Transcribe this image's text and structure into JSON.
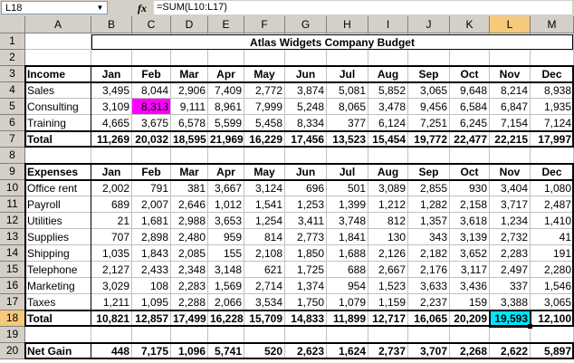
{
  "formula_bar": {
    "name_box": "L18",
    "fx_label": "fx",
    "formula": "=SUM(L10:L17)"
  },
  "columns": [
    "A",
    "B",
    "C",
    "D",
    "E",
    "F",
    "G",
    "H",
    "I",
    "J",
    "K",
    "L",
    "M"
  ],
  "rows": [
    "1",
    "2",
    "3",
    "4",
    "5",
    "6",
    "7",
    "8",
    "9",
    "10",
    "11",
    "12",
    "13",
    "14",
    "15",
    "16",
    "17",
    "18",
    "19",
    "20"
  ],
  "active_cell": {
    "column": "L",
    "row": "18"
  },
  "title": "Atlas Widgets Company Budget",
  "months": [
    "Jan",
    "Feb",
    "Mar",
    "Apr",
    "May",
    "Jun",
    "Jul",
    "Aug",
    "Sep",
    "Oct",
    "Nov",
    "Dec"
  ],
  "income": {
    "header": "Income",
    "rows": [
      {
        "label": "Sales",
        "values": [
          "3,495",
          "8,044",
          "2,906",
          "7,409",
          "2,772",
          "3,874",
          "5,081",
          "5,852",
          "3,065",
          "9,648",
          "8,214",
          "8,938"
        ]
      },
      {
        "label": "Consulting",
        "values": [
          "3,109",
          "8,313",
          "9,111",
          "8,961",
          "7,999",
          "5,248",
          "8,065",
          "3,478",
          "9,456",
          "6,584",
          "6,847",
          "1,935"
        ]
      },
      {
        "label": "Training",
        "values": [
          "4,665",
          "3,675",
          "6,578",
          "5,599",
          "5,458",
          "8,334",
          "377",
          "6,124",
          "7,251",
          "6,245",
          "7,154",
          "7,124"
        ]
      }
    ],
    "total": {
      "label": "Total",
      "values": [
        "11,269",
        "20,032",
        "18,595",
        "21,969",
        "16,229",
        "17,456",
        "13,523",
        "15,454",
        "19,772",
        "22,477",
        "22,215",
        "17,997"
      ]
    }
  },
  "expenses": {
    "header": "Expenses",
    "rows": [
      {
        "label": "Office rent",
        "values": [
          "2,002",
          "791",
          "381",
          "3,667",
          "3,124",
          "696",
          "501",
          "3,089",
          "2,855",
          "930",
          "3,404",
          "1,080"
        ]
      },
      {
        "label": "Payroll",
        "values": [
          "689",
          "2,007",
          "2,646",
          "1,012",
          "1,541",
          "1,253",
          "1,399",
          "1,212",
          "1,282",
          "2,158",
          "3,717",
          "2,487"
        ]
      },
      {
        "label": "Utilities",
        "values": [
          "21",
          "1,681",
          "2,988",
          "3,653",
          "1,254",
          "3,411",
          "3,748",
          "812",
          "1,357",
          "3,618",
          "1,234",
          "1,410"
        ]
      },
      {
        "label": "Supplies",
        "values": [
          "707",
          "2,898",
          "2,480",
          "959",
          "814",
          "2,773",
          "1,841",
          "130",
          "343",
          "3,139",
          "2,732",
          "41"
        ]
      },
      {
        "label": "Shipping",
        "values": [
          "1,035",
          "1,843",
          "2,085",
          "155",
          "2,108",
          "1,850",
          "1,688",
          "2,126",
          "2,182",
          "3,652",
          "2,283",
          "191"
        ]
      },
      {
        "label": "Telephone",
        "values": [
          "2,127",
          "2,433",
          "2,348",
          "3,148",
          "621",
          "1,725",
          "688",
          "2,667",
          "2,176",
          "3,117",
          "2,497",
          "2,280"
        ]
      },
      {
        "label": "Marketing",
        "values": [
          "3,029",
          "108",
          "2,283",
          "1,569",
          "2,714",
          "1,374",
          "954",
          "1,523",
          "3,633",
          "3,436",
          "337",
          "1,546"
        ]
      },
      {
        "label": "Taxes",
        "values": [
          "1,211",
          "1,095",
          "2,288",
          "2,066",
          "3,534",
          "1,750",
          "1,079",
          "1,159",
          "2,237",
          "159",
          "3,388",
          "3,065"
        ]
      }
    ],
    "total": {
      "label": "Total",
      "values": [
        "10,821",
        "12,857",
        "17,499",
        "16,228",
        "15,709",
        "14,833",
        "11,899",
        "12,717",
        "16,065",
        "20,209",
        "19,593",
        "12,100"
      ]
    }
  },
  "net_gain": {
    "label": "Net Gain",
    "values": [
      "448",
      "7,175",
      "1,096",
      "5,741",
      "520",
      "2,623",
      "1,624",
      "2,737",
      "3,707",
      "2,268",
      "2,622",
      "5,897"
    ]
  },
  "highlights": {
    "consulting_feb_fill": "#ff00ff",
    "total_nov_fill": "#00e5ff",
    "active_header_fill": "#f6c97b"
  }
}
